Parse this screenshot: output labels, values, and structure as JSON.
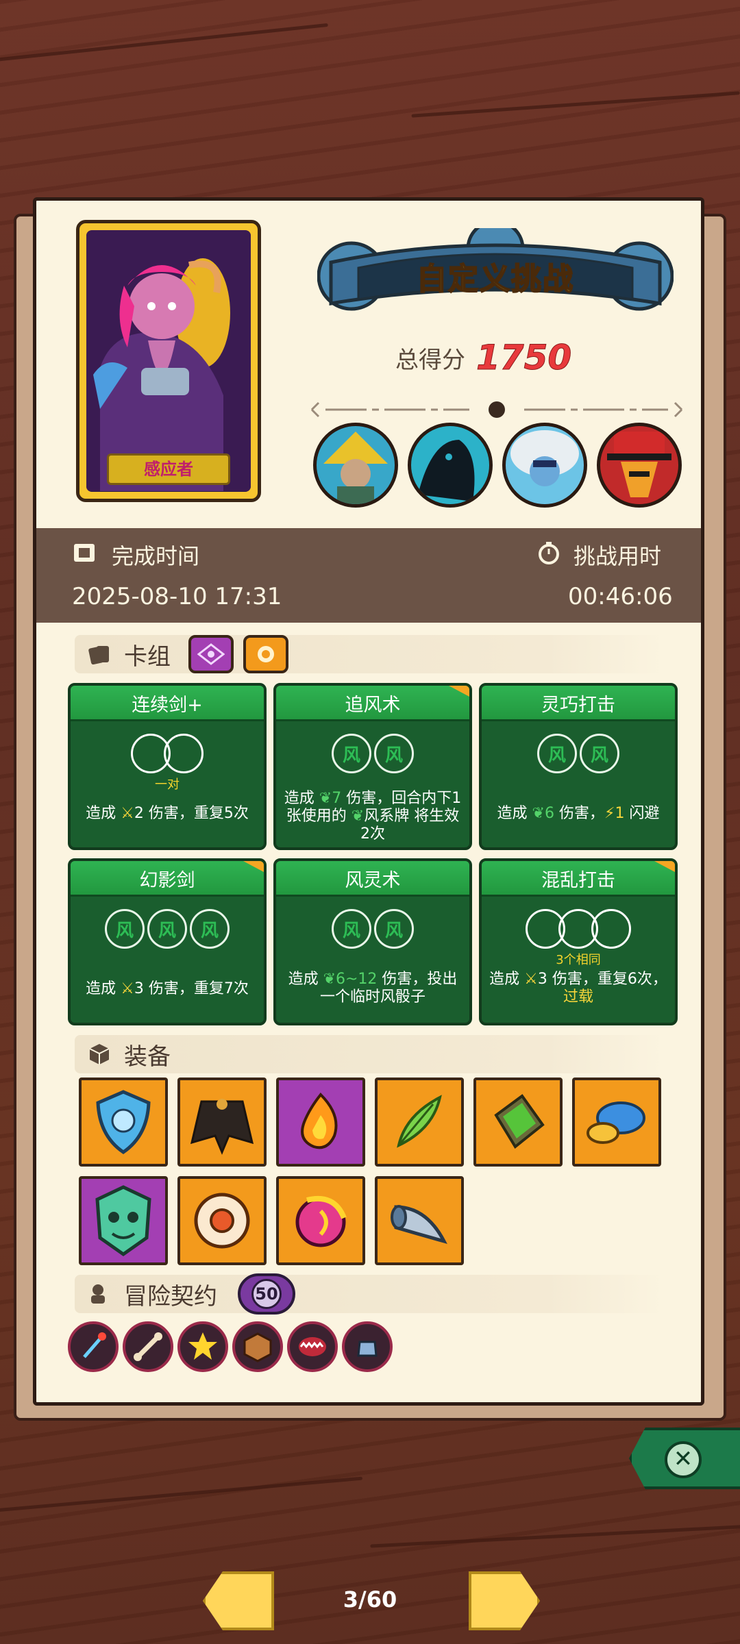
{
  "header": {
    "title": "自定义挑战",
    "score_label": "总得分",
    "score_value": "1750"
  },
  "hero": {
    "name": "感应者"
  },
  "companions": [
    "straw-hat-elder",
    "shadow-creature",
    "white-fur-child",
    "red-hat-mask"
  ],
  "info": {
    "finish_label": "完成时间",
    "finish_value": "2025-08-10 17:31",
    "duration_label": "挑战用时",
    "duration_value": "00:46:06"
  },
  "deck": {
    "title": "卡组",
    "cards": [
      {
        "name": "连续剑+",
        "slot_tag": "一对",
        "desc_a": "造成",
        "desc_b": "2 伤害，重复5次"
      },
      {
        "name": "追风术",
        "desc_a": "造成",
        "desc_b": "7",
        "desc_c": " 伤害，回合内下1张使用的 ",
        "desc_d": "风系牌 将生效2次"
      },
      {
        "name": "灵巧打击",
        "desc_a": "造成 ",
        "desc_b": "6",
        "desc_c": " 伤害，",
        "desc_d": "1",
        "desc_e": " 闪避"
      },
      {
        "name": "幻影剑",
        "desc_a": "造成",
        "desc_b": "3 伤害，重复7次"
      },
      {
        "name": "风灵术",
        "desc_a": "造成 ",
        "desc_b": "6~12",
        "desc_c": " 伤害，投出一个临时风骰子"
      },
      {
        "name": "混乱打击",
        "slot_tag": "3个相同",
        "desc_a": "造成",
        "desc_b": "3 伤害，重复6次，",
        "desc_c": "过载"
      }
    ]
  },
  "equipment": {
    "title": "装备",
    "items": [
      {
        "icon": "blue-shield-icon",
        "rarity": "orange"
      },
      {
        "icon": "dark-cloak-icon",
        "rarity": "orange"
      },
      {
        "icon": "flame-fruit-icon",
        "rarity": "purple"
      },
      {
        "icon": "green-feather-icon",
        "rarity": "orange"
      },
      {
        "icon": "moss-stone-icon",
        "rarity": "orange"
      },
      {
        "icon": "blue-mushroom-icon",
        "rarity": "orange"
      },
      {
        "icon": "demon-mask-icon",
        "rarity": "purple"
      },
      {
        "icon": "white-ring-icon",
        "rarity": "orange"
      },
      {
        "icon": "magic-orb-icon",
        "rarity": "orange"
      },
      {
        "icon": "horn-icon",
        "rarity": "orange"
      }
    ]
  },
  "contract": {
    "title": "冒险契约",
    "level": "50",
    "icons": [
      "trident-icon",
      "bone-icon",
      "burst-icon",
      "crate-icon",
      "jaws-icon",
      "fist-icon"
    ]
  },
  "pager": {
    "text": "3/60"
  },
  "colors": {
    "card_green": "#1a5e2e",
    "score_red": "#e8393c",
    "title_yellow": "#ffd52e"
  }
}
